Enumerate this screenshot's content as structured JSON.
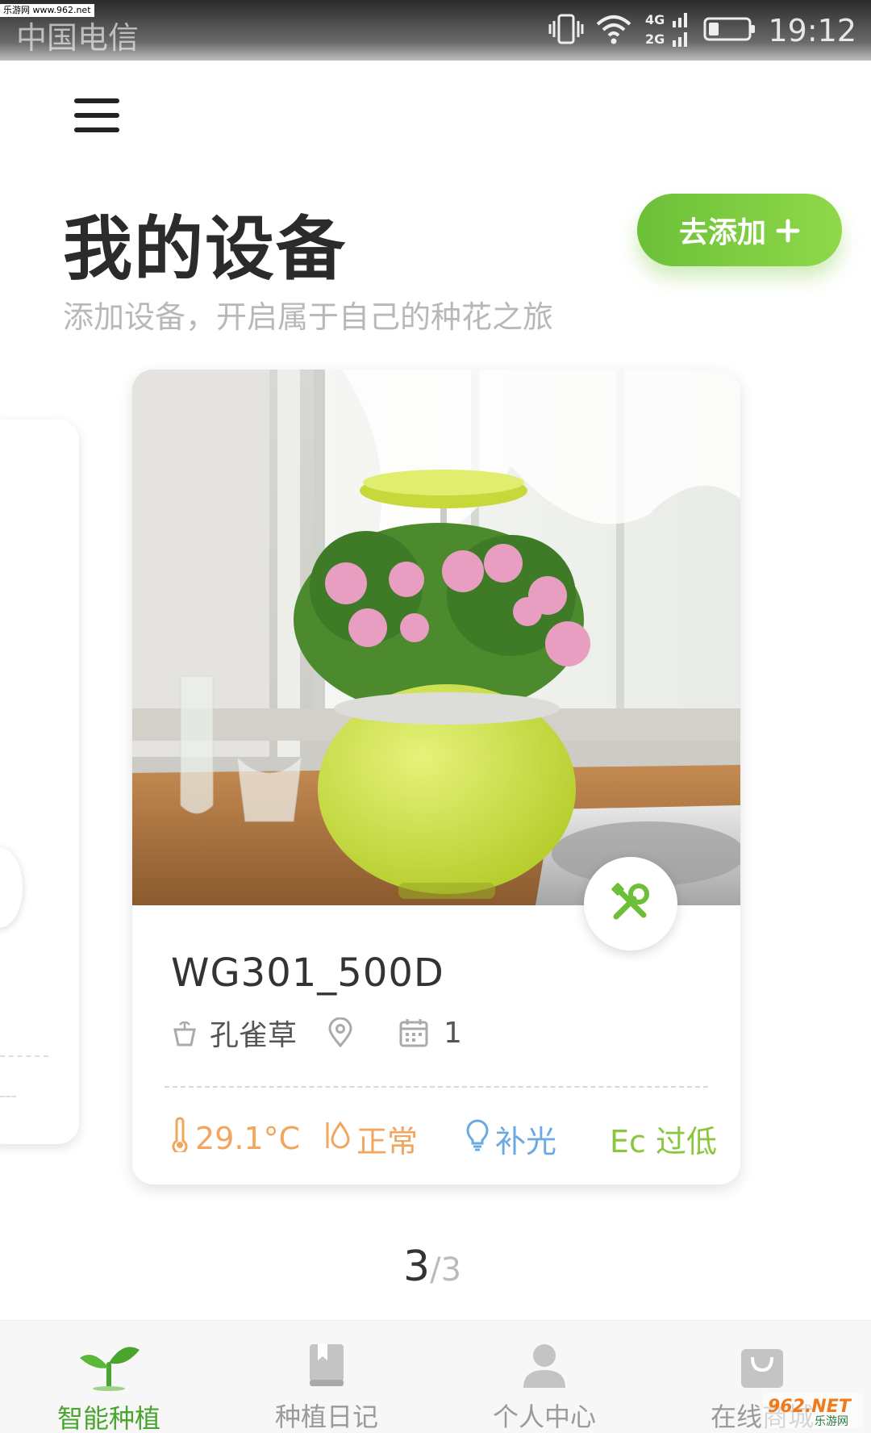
{
  "status_bar": {
    "watermark": "乐游网 www.962.net",
    "carrier": "中国电信",
    "network_4g": "4G",
    "network_2g": "2G",
    "time": "19:12"
  },
  "header": {
    "title": "我的设备",
    "subtitle": "添加设备，开启属于自己的种花之旅",
    "add_button_label": "去添加"
  },
  "device_card": {
    "name": "WG301_500D",
    "plant": "孔雀草",
    "location": "",
    "day_count": "1",
    "stats": {
      "temperature": "29.1°C",
      "water": "正常",
      "light": "补光",
      "ec": "Ec 过低"
    },
    "colors": {
      "temperature": "#f2a55c",
      "water": "#f2a55c",
      "light": "#6aa9e3",
      "ec": "#8cc63f"
    }
  },
  "pager": {
    "current": "3",
    "separator": "/",
    "total": "3"
  },
  "bottom_nav": {
    "items": [
      {
        "label": "智能种植",
        "icon": "sprout-icon",
        "active": true
      },
      {
        "label": "种植日记",
        "icon": "diary-icon",
        "active": false
      },
      {
        "label": "个人中心",
        "icon": "person-icon",
        "active": false
      },
      {
        "label": "在线商城",
        "icon": "shopping-bag-icon",
        "active": false
      }
    ]
  },
  "site_watermark": {
    "brand": "962.NET",
    "name": "乐游网"
  },
  "accent_color": "#78c83f"
}
